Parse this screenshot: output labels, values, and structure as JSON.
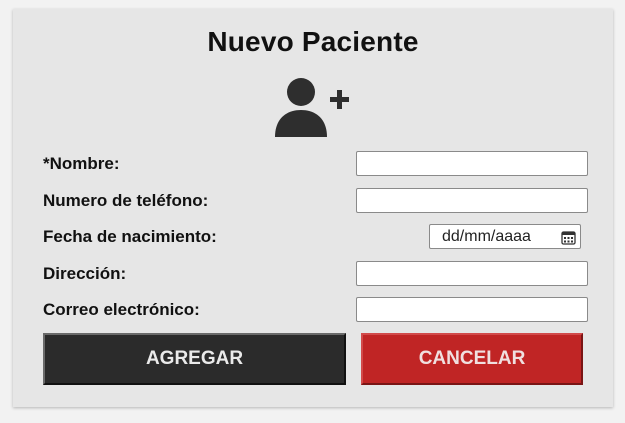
{
  "form": {
    "title": "Nuevo Paciente",
    "header_icon": "user-plus-icon",
    "fields": {
      "nombre": {
        "label": "*Nombre:",
        "value": ""
      },
      "telefono": {
        "label": "Numero de teléfono:",
        "value": ""
      },
      "fecha": {
        "label": "Fecha de nacimiento:",
        "value": "dd/mm/aaaa",
        "icon": "calendar-icon"
      },
      "direccion": {
        "label": "Dirección:",
        "value": ""
      },
      "correo": {
        "label": "Correo electrónico:",
        "value": ""
      }
    },
    "buttons": {
      "add_label": "AGREGAR",
      "cancel_label": "CANCELAR"
    }
  },
  "colors": {
    "card_background": "#e6e6e6",
    "page_background": "#f2f2f2",
    "add_button": "#2b2b2b",
    "cancel_button": "#c02525"
  }
}
